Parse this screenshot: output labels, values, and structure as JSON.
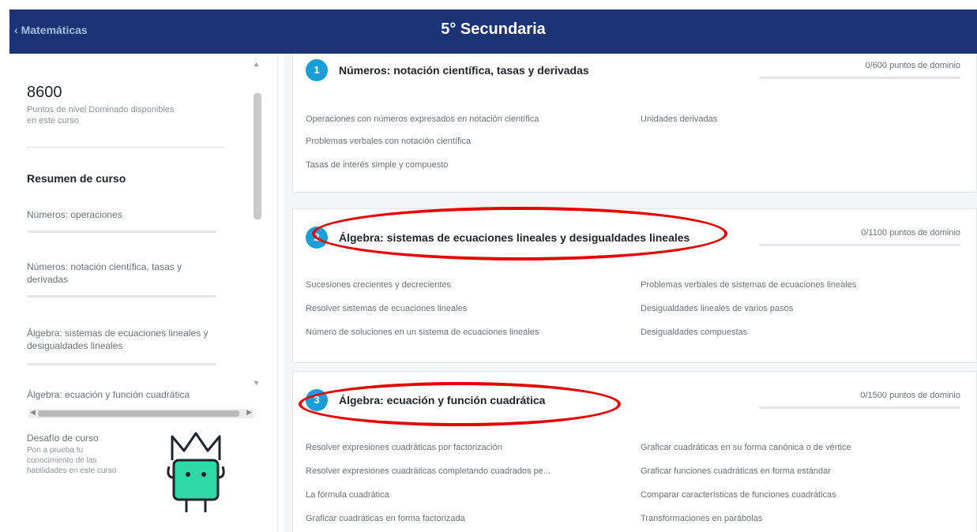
{
  "header": {
    "back_label": "Matemáticas",
    "title": "5° Secundaria"
  },
  "sidebar": {
    "points_value": "8600",
    "points_description": "Puntos de nivel Dominado disponibles en este curso",
    "summary_title": "Resumen de curso",
    "items": [
      {
        "label": "Números: operaciones"
      },
      {
        "label": "Números: notación científica, tasas y derivadas"
      },
      {
        "label": "Álgebra: sistemas de ecuaciones lineales y desigualdades lineales"
      },
      {
        "label": "Álgebra: ecuación y función cuadrática"
      }
    ],
    "challenge_title": "Desafío de curso",
    "challenge_description": "Pon a prueba tu conocimiento de las habilidades en este curso"
  },
  "units": [
    {
      "icon_label": "1",
      "title": "Números: notación científica, tasas y derivadas",
      "points": "0/600 puntos de dominio",
      "skills_left": [
        "Operaciones con números expresados en notación científica",
        "Problemas verbales con notación científica",
        "Tasas de interés simple y compuesto"
      ],
      "skills_right": [
        "Unidades derivadas"
      ]
    },
    {
      "icon_label": "2",
      "title": "Álgebra: sistemas de ecuaciones lineales y desigualdades lineales",
      "points": "0/1100 puntos de dominio",
      "skills_left": [
        "Sucesiones crecientes y decrecientes",
        "Resolver sistemas de ecuaciones lineales",
        "Número de soluciones en un sistema de ecuaciones lineales"
      ],
      "skills_right": [
        "Problemas verbales de sistemas de ecuaciones lineales",
        "Desigualdades lineales de varios pasos",
        "Desigualdades compuestas"
      ]
    },
    {
      "icon_label": "3",
      "title": "Álgebra: ecuación y función cuadrática",
      "points": "0/1500 puntos de dominio",
      "skills_left": [
        "Resolver expresiones cuadráticas por factorización",
        "Resolver expresiones cuadráticas completando cuadrados pe...",
        "La fórmula cuadrática",
        "Graficar cuadráticas en forma factorizada"
      ],
      "skills_right": [
        "Graficar cuadráticas en su forma canónica o de vértice",
        "Graficar funciones cuadráticas en forma estándar",
        "Comparar características de funciones cuadráticas",
        "Transformaciones en parábolas"
      ]
    }
  ],
  "colors": {
    "header_bg": "#1c3473",
    "unit_icon": "#1a9ed8",
    "annotation": "#e60000",
    "mascot": "#2fd9a6"
  }
}
